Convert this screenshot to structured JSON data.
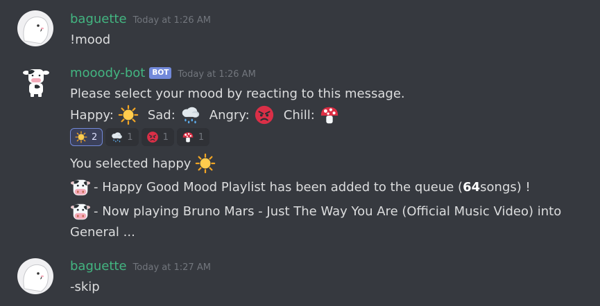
{
  "messages": [
    {
      "username": "baguette",
      "timestamp": "Today at 1:26 AM",
      "text": "!mood"
    },
    {
      "username": "mooody-bot",
      "bot_tag": "BOT",
      "timestamp": "Today at 1:26 AM",
      "prompt": "Please select your mood by reacting to this message.",
      "moods": [
        {
          "label": "Happy:",
          "icon": "sun-icon"
        },
        {
          "label": "Sad:",
          "icon": "rain-cloud-icon"
        },
        {
          "label": "Angry:",
          "icon": "angry-face-icon"
        },
        {
          "label": "Chill:",
          "icon": "mushroom-icon"
        }
      ],
      "reactions": [
        {
          "icon": "sun-icon",
          "count": "2",
          "active": true
        },
        {
          "icon": "rain-cloud-icon",
          "count": "1",
          "active": false
        },
        {
          "icon": "angry-face-icon",
          "count": "1",
          "active": false
        },
        {
          "icon": "mushroom-icon",
          "count": "1",
          "active": false
        }
      ],
      "selected_text": "You selected happy",
      "queue_prefix": "- Happy Good Mood Playlist has been added to the queue (",
      "queue_count": "64",
      "queue_suffix": " songs) !",
      "now_playing_line1": "- Now playing Bruno Mars - Just The Way You Are (Official Music Video) into",
      "now_playing_line2": "General ..."
    },
    {
      "username": "baguette",
      "timestamp": "Today at 1:27 AM",
      "text": "-skip"
    }
  ],
  "colors": {
    "background": "#36393f",
    "username": "#43b581",
    "timestamp": "#72767d",
    "text": "#dcddde",
    "bot_tag": "#7289da",
    "reaction_active_border": "#7289da"
  }
}
